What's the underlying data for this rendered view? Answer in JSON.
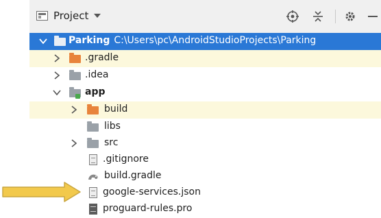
{
  "toolbar": {
    "title": "Project",
    "icons": [
      "target-icon",
      "collapse-all-icon",
      "gear-icon",
      "hide-icon"
    ]
  },
  "tree": [
    {
      "label": "Parking",
      "path": "C:\\Users\\pc\\AndroidStudioProjects\\Parking",
      "state": "expanded",
      "selected": true,
      "icon": "project-folder-icon"
    },
    {
      "label": ".gradle",
      "state": "collapsed",
      "icon": "excluded-folder-icon"
    },
    {
      "label": ".idea",
      "state": "collapsed",
      "icon": "folder-icon"
    },
    {
      "label": "app",
      "state": "expanded",
      "icon": "module-folder-icon"
    },
    {
      "label": "build",
      "state": "collapsed",
      "icon": "excluded-folder-icon"
    },
    {
      "label": "libs",
      "icon": "folder-icon"
    },
    {
      "label": "src",
      "state": "collapsed",
      "icon": "folder-icon"
    },
    {
      "label": ".gitignore",
      "icon": "gitignore-file-icon"
    },
    {
      "label": "build.gradle",
      "icon": "gradle-file-icon"
    },
    {
      "label": "google-services.json",
      "icon": "json-file-icon"
    },
    {
      "label": "proguard-rules.pro",
      "icon": "text-file-icon"
    }
  ],
  "annotation": {
    "pointer": "yellow-arrow",
    "points_to": "google-services.json"
  },
  "colors": {
    "selection": "#2a78d6",
    "excluded_row": "#fcf8dc",
    "excluded_folder": "#e8843c",
    "arrow": "#f2c94c"
  }
}
